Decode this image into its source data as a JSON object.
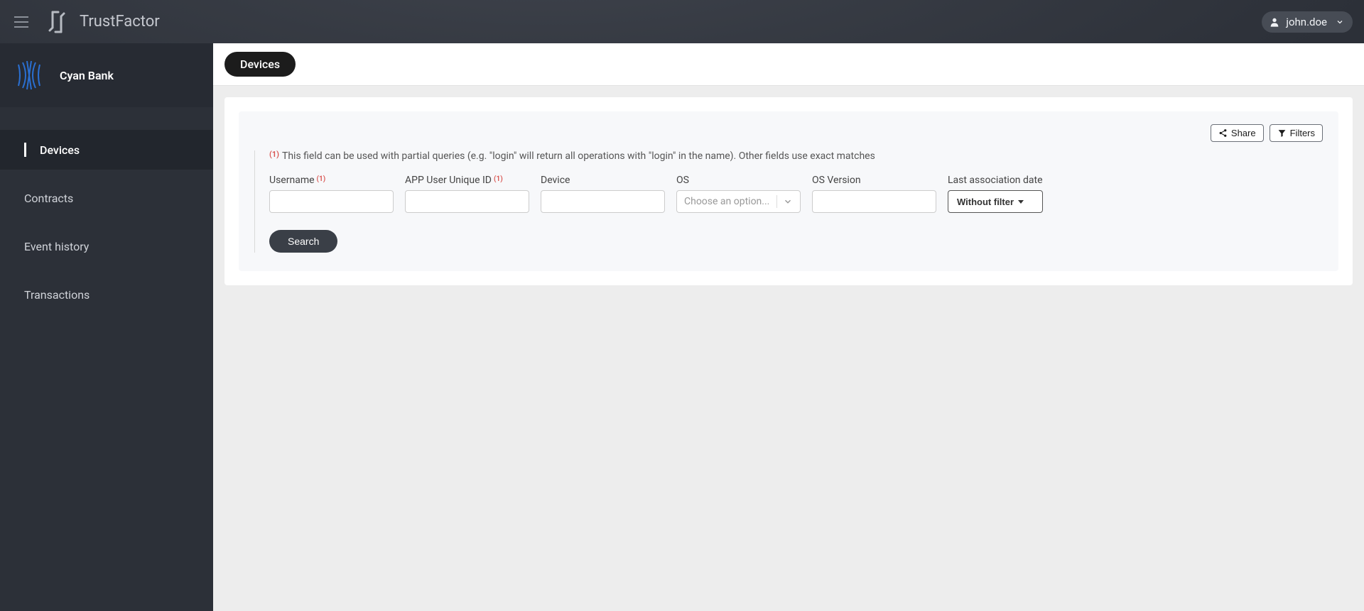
{
  "header": {
    "brand": "TrustFactor",
    "user": "john.doe"
  },
  "sidebar": {
    "org_name": "Cyan Bank",
    "items": [
      {
        "label": "Devices",
        "active": true
      },
      {
        "label": "Contracts",
        "active": false
      },
      {
        "label": "Event history",
        "active": false
      },
      {
        "label": "Transactions",
        "active": false
      }
    ]
  },
  "main": {
    "page_tab": "Devices",
    "filter": {
      "share_label": "Share",
      "filters_label": "Filters",
      "hint_sup": "(1)",
      "hint_text": "This field can be used with partial queries (e.g. \"login\" will return all operations with \"login\" in the name). Other fields use exact matches",
      "fields": {
        "username": {
          "label": "Username",
          "sup": "(1)",
          "value": ""
        },
        "app_user_id": {
          "label": "APP User Unique ID",
          "sup": "(1)",
          "value": ""
        },
        "device": {
          "label": "Device",
          "value": ""
        },
        "os": {
          "label": "OS",
          "placeholder": "Choose an option..."
        },
        "os_version": {
          "label": "OS Version",
          "value": ""
        },
        "last_assoc": {
          "label": "Last association date",
          "button_label": "Without filter"
        }
      },
      "search_label": "Search"
    }
  }
}
